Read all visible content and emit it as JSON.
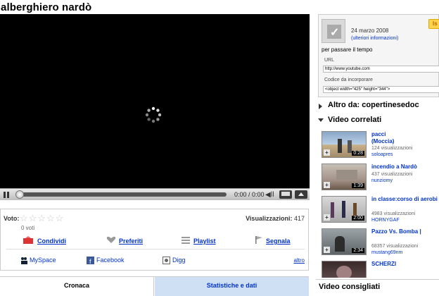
{
  "video": {
    "title": "alberghiero nardò",
    "time": "0:00 / 0:00"
  },
  "rating": {
    "label": "Voto:",
    "stars": "☆☆☆☆☆",
    "votes": "0 voti",
    "views_label": "Visualizzazioni:",
    "views_value": "417"
  },
  "actions": {
    "share": "Condividi",
    "favorites": "Preferiti",
    "playlist": "Playlist",
    "flag": "Segnala"
  },
  "share_sites": {
    "myspace": "MySpace",
    "facebook": "Facebook",
    "digg": "Digg",
    "more": "altro"
  },
  "tabs": {
    "active": "Cronaca",
    "other": "Statistiche e dati"
  },
  "channel": {
    "date": "24 marzo 2008",
    "more_info": "(ulteriori informazioni)",
    "subscribe": "Is",
    "description": "per passare il tempo",
    "url_label": "URL",
    "url_value": "http://www.youtube.com",
    "embed_label": "Codice da incorporare",
    "embed_value": "<object width=\"425\" height=\"344\">"
  },
  "sections": {
    "more_from": "Altro da: copertinesedoc",
    "related": "Video correlati",
    "recommended": "Video consigliati"
  },
  "related": [
    {
      "title": "pacci",
      "title2": "(Moccia)",
      "views": "124 visualizzazioni",
      "user": "soloapres",
      "duration": "0:28"
    },
    {
      "title": "incendio a Nardò",
      "title2": "",
      "views": "437 visualizzazioni",
      "user": "nunziomy",
      "duration": "1:39"
    },
    {
      "title": "in classe:corso di aerobi",
      "title2": "",
      "views": "4983 visualizzazioni",
      "user": "HORNYGAF",
      "duration": "2:00"
    },
    {
      "title": "Pazzo Vs. Bomba |",
      "title2": "",
      "views": "68357 visualizzazioni",
      "user": "mustang69nm",
      "duration": "2:34"
    },
    {
      "title": "SCHERZI",
      "title2": "",
      "views": "",
      "user": "",
      "duration": ""
    }
  ]
}
